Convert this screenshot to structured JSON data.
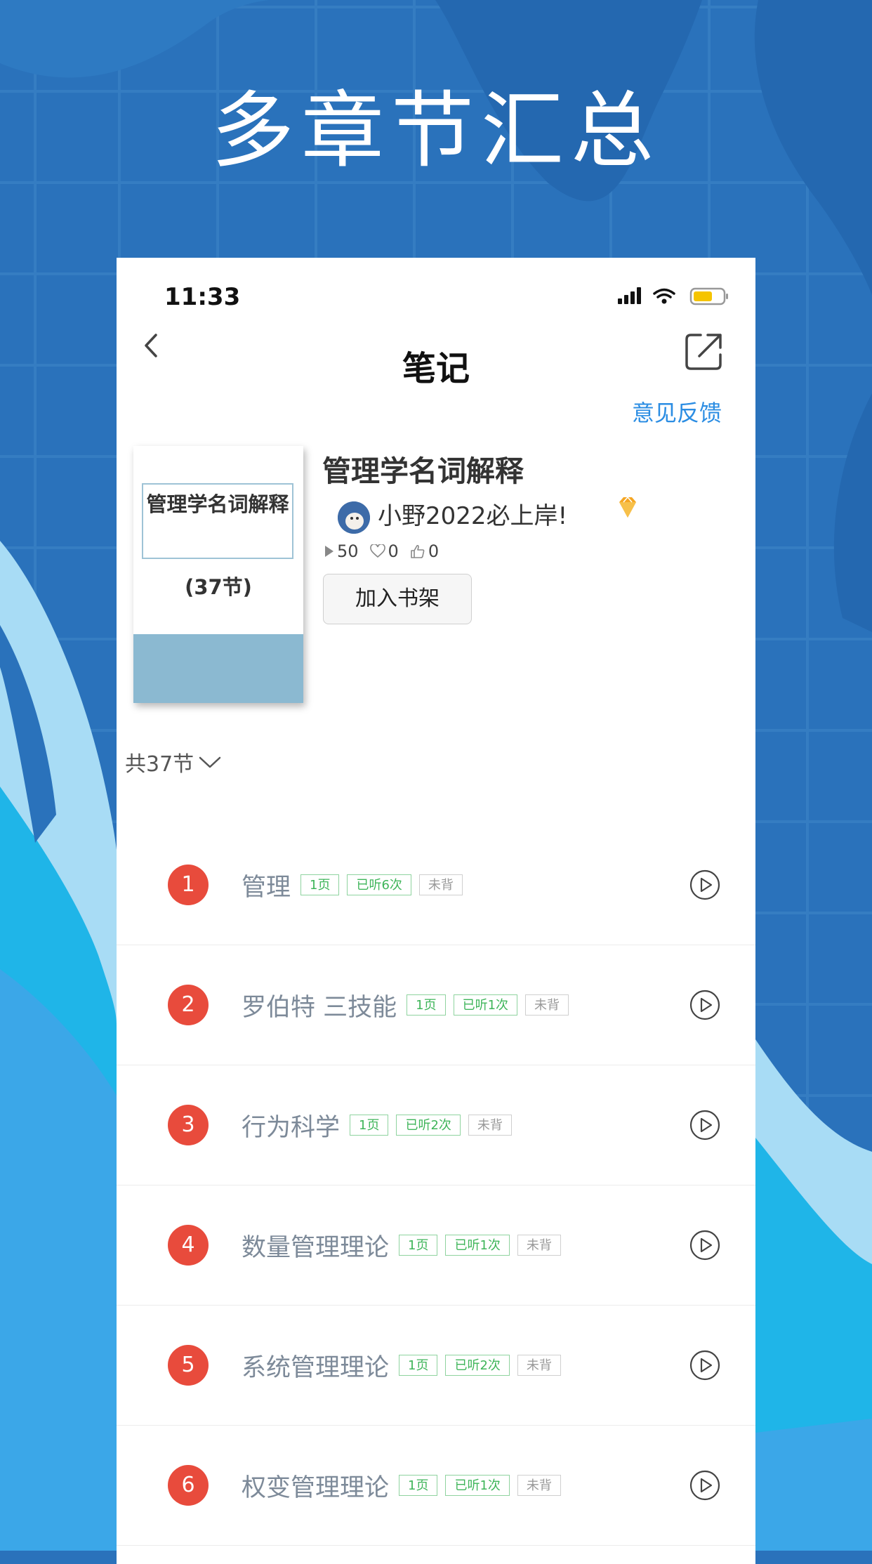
{
  "headline": "多章节汇总",
  "colors": {
    "background_blue": "#2a72bb",
    "accent_red": "#e84b3c",
    "link_blue": "#2b8de3",
    "tag_green": "#3fb55a"
  },
  "status_bar": {
    "time": "11:33",
    "icons": [
      "signal-icon",
      "wifi-icon",
      "battery-icon"
    ]
  },
  "nav": {
    "title": "笔记",
    "back_icon": "chevron-left-icon",
    "share_icon": "share-icon",
    "feedback": "意见反馈"
  },
  "book": {
    "cover_title": "管理学名词解释",
    "cover_count": "(37节)",
    "title": "管理学名词解释",
    "author": "小野2022必上岸!",
    "plays": "50",
    "likes": "0",
    "thumbs": "0",
    "shelf_button": "加入书架"
  },
  "chapter_count": "共37节",
  "chapters": [
    {
      "num": "1",
      "title": "管理",
      "pages": "1页",
      "listened": "已听6次",
      "status": "未背"
    },
    {
      "num": "2",
      "title": "罗伯特 三技能",
      "pages": "1页",
      "listened": "已听1次",
      "status": "未背"
    },
    {
      "num": "3",
      "title": "行为科学",
      "pages": "1页",
      "listened": "已听2次",
      "status": "未背"
    },
    {
      "num": "4",
      "title": "数量管理理论",
      "pages": "1页",
      "listened": "已听1次",
      "status": "未背"
    },
    {
      "num": "5",
      "title": "系统管理理论",
      "pages": "1页",
      "listened": "已听2次",
      "status": "未背"
    },
    {
      "num": "6",
      "title": "权变管理理论",
      "pages": "1页",
      "listened": "已听1次",
      "status": "未背"
    }
  ]
}
